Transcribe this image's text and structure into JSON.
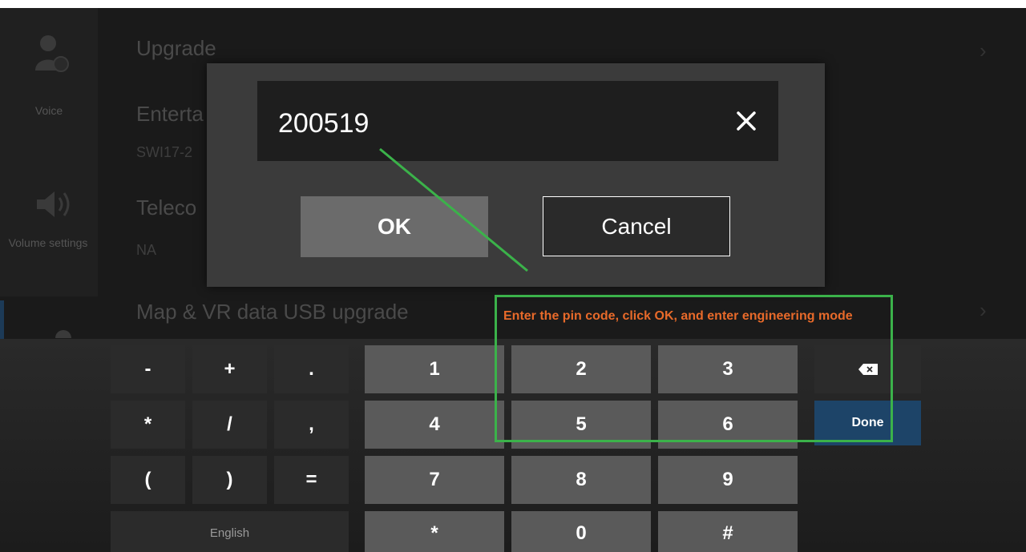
{
  "background": {
    "rows": [
      {
        "title": "Upgrade",
        "sub": ""
      },
      {
        "title": "Enterta",
        "sub": "SWI17-2"
      },
      {
        "title": "Teleco",
        "sub": "NA"
      },
      {
        "title": "Map & VR data USB upgrade",
        "sub": ""
      }
    ],
    "sidebar": [
      {
        "label": "Voice"
      },
      {
        "label": "Volume settings"
      }
    ]
  },
  "dialog": {
    "pin_value": "200519",
    "ok_label": "OK",
    "cancel_label": "Cancel"
  },
  "keyboard": {
    "rows": [
      [
        "-",
        "+",
        ".",
        "1",
        "2",
        "3"
      ],
      [
        "*",
        "/",
        ",",
        "4",
        "5",
        "6"
      ],
      [
        "(",
        ")",
        "=",
        "7",
        "8",
        "9"
      ],
      [
        "*",
        "0",
        "#"
      ]
    ],
    "language_label": "English",
    "done_label": "Done"
  },
  "annotation": {
    "text": "Enter the pin code, click OK, and enter engineering mode"
  },
  "colors": {
    "annotation_border": "#3bb24a",
    "annotation_text": "#e86a2a",
    "done_key": "#1d4468"
  }
}
